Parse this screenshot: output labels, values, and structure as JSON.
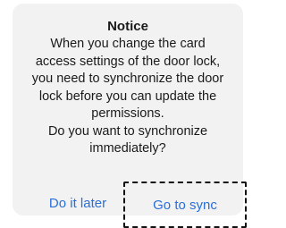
{
  "dialog": {
    "title": "Notice",
    "message": "When you change the card\naccess settings of the door lock,\nyou need to synchronize the door\nlock before you can update the\npermissions.\nDo you want to synchronize\nimmediately?",
    "buttons": {
      "later_label": "Do it later",
      "sync_label": "Go to sync"
    }
  },
  "colors": {
    "dialog_background": "#f2f2f2",
    "button_text": "#2a6fd6",
    "highlight_border": "#111111"
  }
}
